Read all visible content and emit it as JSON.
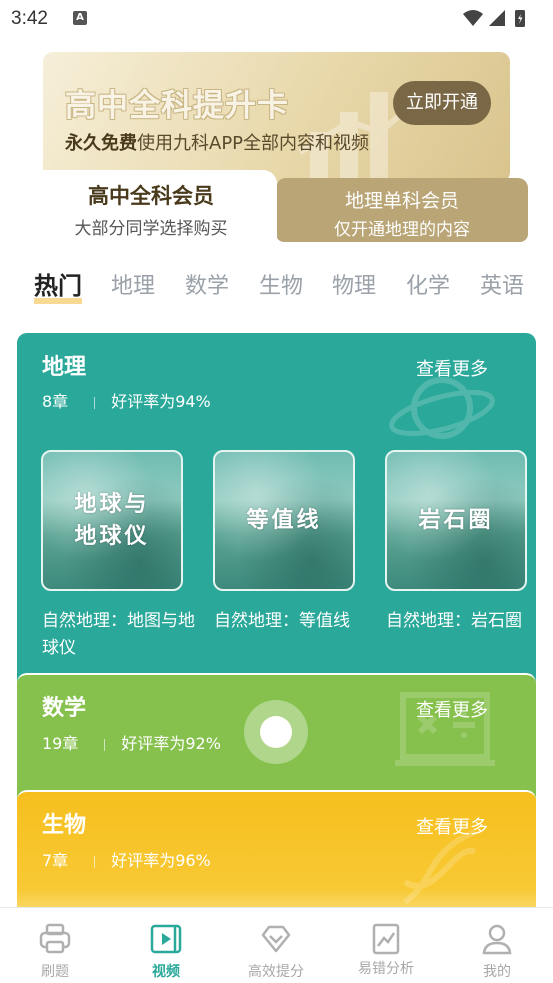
{
  "status_bar": {
    "time": "3:42",
    "notif_icon": "A"
  },
  "banner": {
    "title": "高中全科提升卡",
    "sub_bold": "永久免费",
    "sub_rest": "使用九科APP全部内容和视频",
    "button": "立即开通"
  },
  "member_tabs": [
    {
      "title": "高中全科会员",
      "desc": "大部分同学选择购买"
    },
    {
      "title": "地理单科会员",
      "desc": "仅开通地理的内容"
    }
  ],
  "subject_tabs": [
    "热门",
    "地理",
    "数学",
    "生物",
    "物理",
    "化学",
    "英语"
  ],
  "cards": {
    "geo": {
      "title": "地理",
      "more": "查看更多",
      "chapters": "8章",
      "rating": "好评率为94%",
      "items": [
        {
          "thumb_line1": "地球与",
          "thumb_line2": "地球仪",
          "caption": "自然地理：地图与地球仪"
        },
        {
          "thumb_line1": "等值线",
          "thumb_line2": "",
          "caption": "自然地理：等值线"
        },
        {
          "thumb_line1": "岩石圈",
          "thumb_line2": "",
          "caption": "自然地理：岩石圈"
        }
      ]
    },
    "math": {
      "title": "数学",
      "more": "查看更多",
      "chapters": "19章",
      "rating": "好评率为92%"
    },
    "bio": {
      "title": "生物",
      "more": "查看更多",
      "chapters": "7章",
      "rating": "好评率为96%"
    }
  },
  "bottom_nav": [
    {
      "label": "刷题",
      "icon": "printer-icon"
    },
    {
      "label": "视频",
      "icon": "video-icon"
    },
    {
      "label": "高效提分",
      "icon": "diamond-check-icon"
    },
    {
      "label": "易错分析",
      "icon": "chart-icon"
    },
    {
      "label": "我的",
      "icon": "user-icon"
    }
  ],
  "colors": {
    "geo": "#2aa89a",
    "math": "#86c04d",
    "bio": "#f6bf1e",
    "gold": "#b9a576",
    "active_nav": "#2aa89a"
  }
}
